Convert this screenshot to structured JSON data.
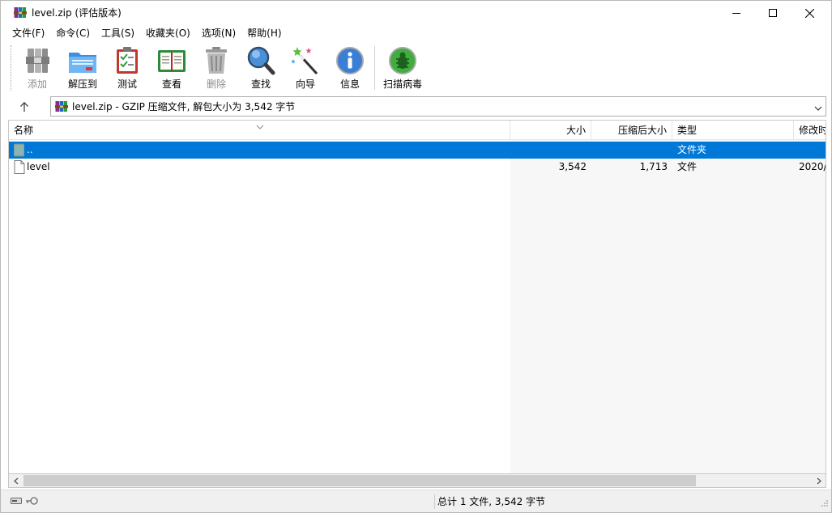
{
  "window": {
    "title": "level.zip (评估版本)",
    "app_icon": "winrar-books-icon"
  },
  "menu": {
    "items": [
      {
        "label": "文件(F)"
      },
      {
        "label": "命令(C)"
      },
      {
        "label": "工具(S)"
      },
      {
        "label": "收藏夹(O)"
      },
      {
        "label": "选项(N)"
      },
      {
        "label": "帮助(H)"
      }
    ]
  },
  "toolbar": {
    "add": {
      "label": "添加",
      "icon": "add-archive-icon",
      "enabled": false
    },
    "extract": {
      "label": "解压到",
      "icon": "extract-folder-icon",
      "enabled": true
    },
    "test": {
      "label": "测试",
      "icon": "test-checklist-icon",
      "enabled": true
    },
    "view": {
      "label": "查看",
      "icon": "view-book-icon",
      "enabled": true
    },
    "delete": {
      "label": "删除",
      "icon": "trash-can-icon",
      "enabled": false
    },
    "find": {
      "label": "查找",
      "icon": "magnifier-icon",
      "enabled": true
    },
    "wizard": {
      "label": "向导",
      "icon": "magic-wand-icon",
      "enabled": true
    },
    "info": {
      "label": "信息",
      "icon": "info-icon",
      "enabled": true
    },
    "virus": {
      "label": "扫描病毒",
      "icon": "virus-scan-bug-icon",
      "enabled": true
    }
  },
  "address": {
    "text": "level.zip - GZIP 压缩文件, 解包大小为 3,542 字节",
    "icon": "winrar-books-icon"
  },
  "columns": {
    "name": "名称",
    "size": "大小",
    "packed": "压缩后大小",
    "type": "类型",
    "modified": "修改时"
  },
  "rows": [
    {
      "name": "..",
      "size": "",
      "packed": "",
      "type": "文件夹",
      "modified": "",
      "icon": "parent-folder-icon",
      "selected": true
    },
    {
      "name": "level",
      "size": "3,542",
      "packed": "1,713",
      "type": "文件",
      "modified": "2020/",
      "icon": "file-icon",
      "selected": false
    }
  ],
  "status": {
    "text": "总计 1 文件, 3,542 字节"
  },
  "colors": {
    "selection": "#0078d7",
    "chrome": "#f0f0f0"
  }
}
